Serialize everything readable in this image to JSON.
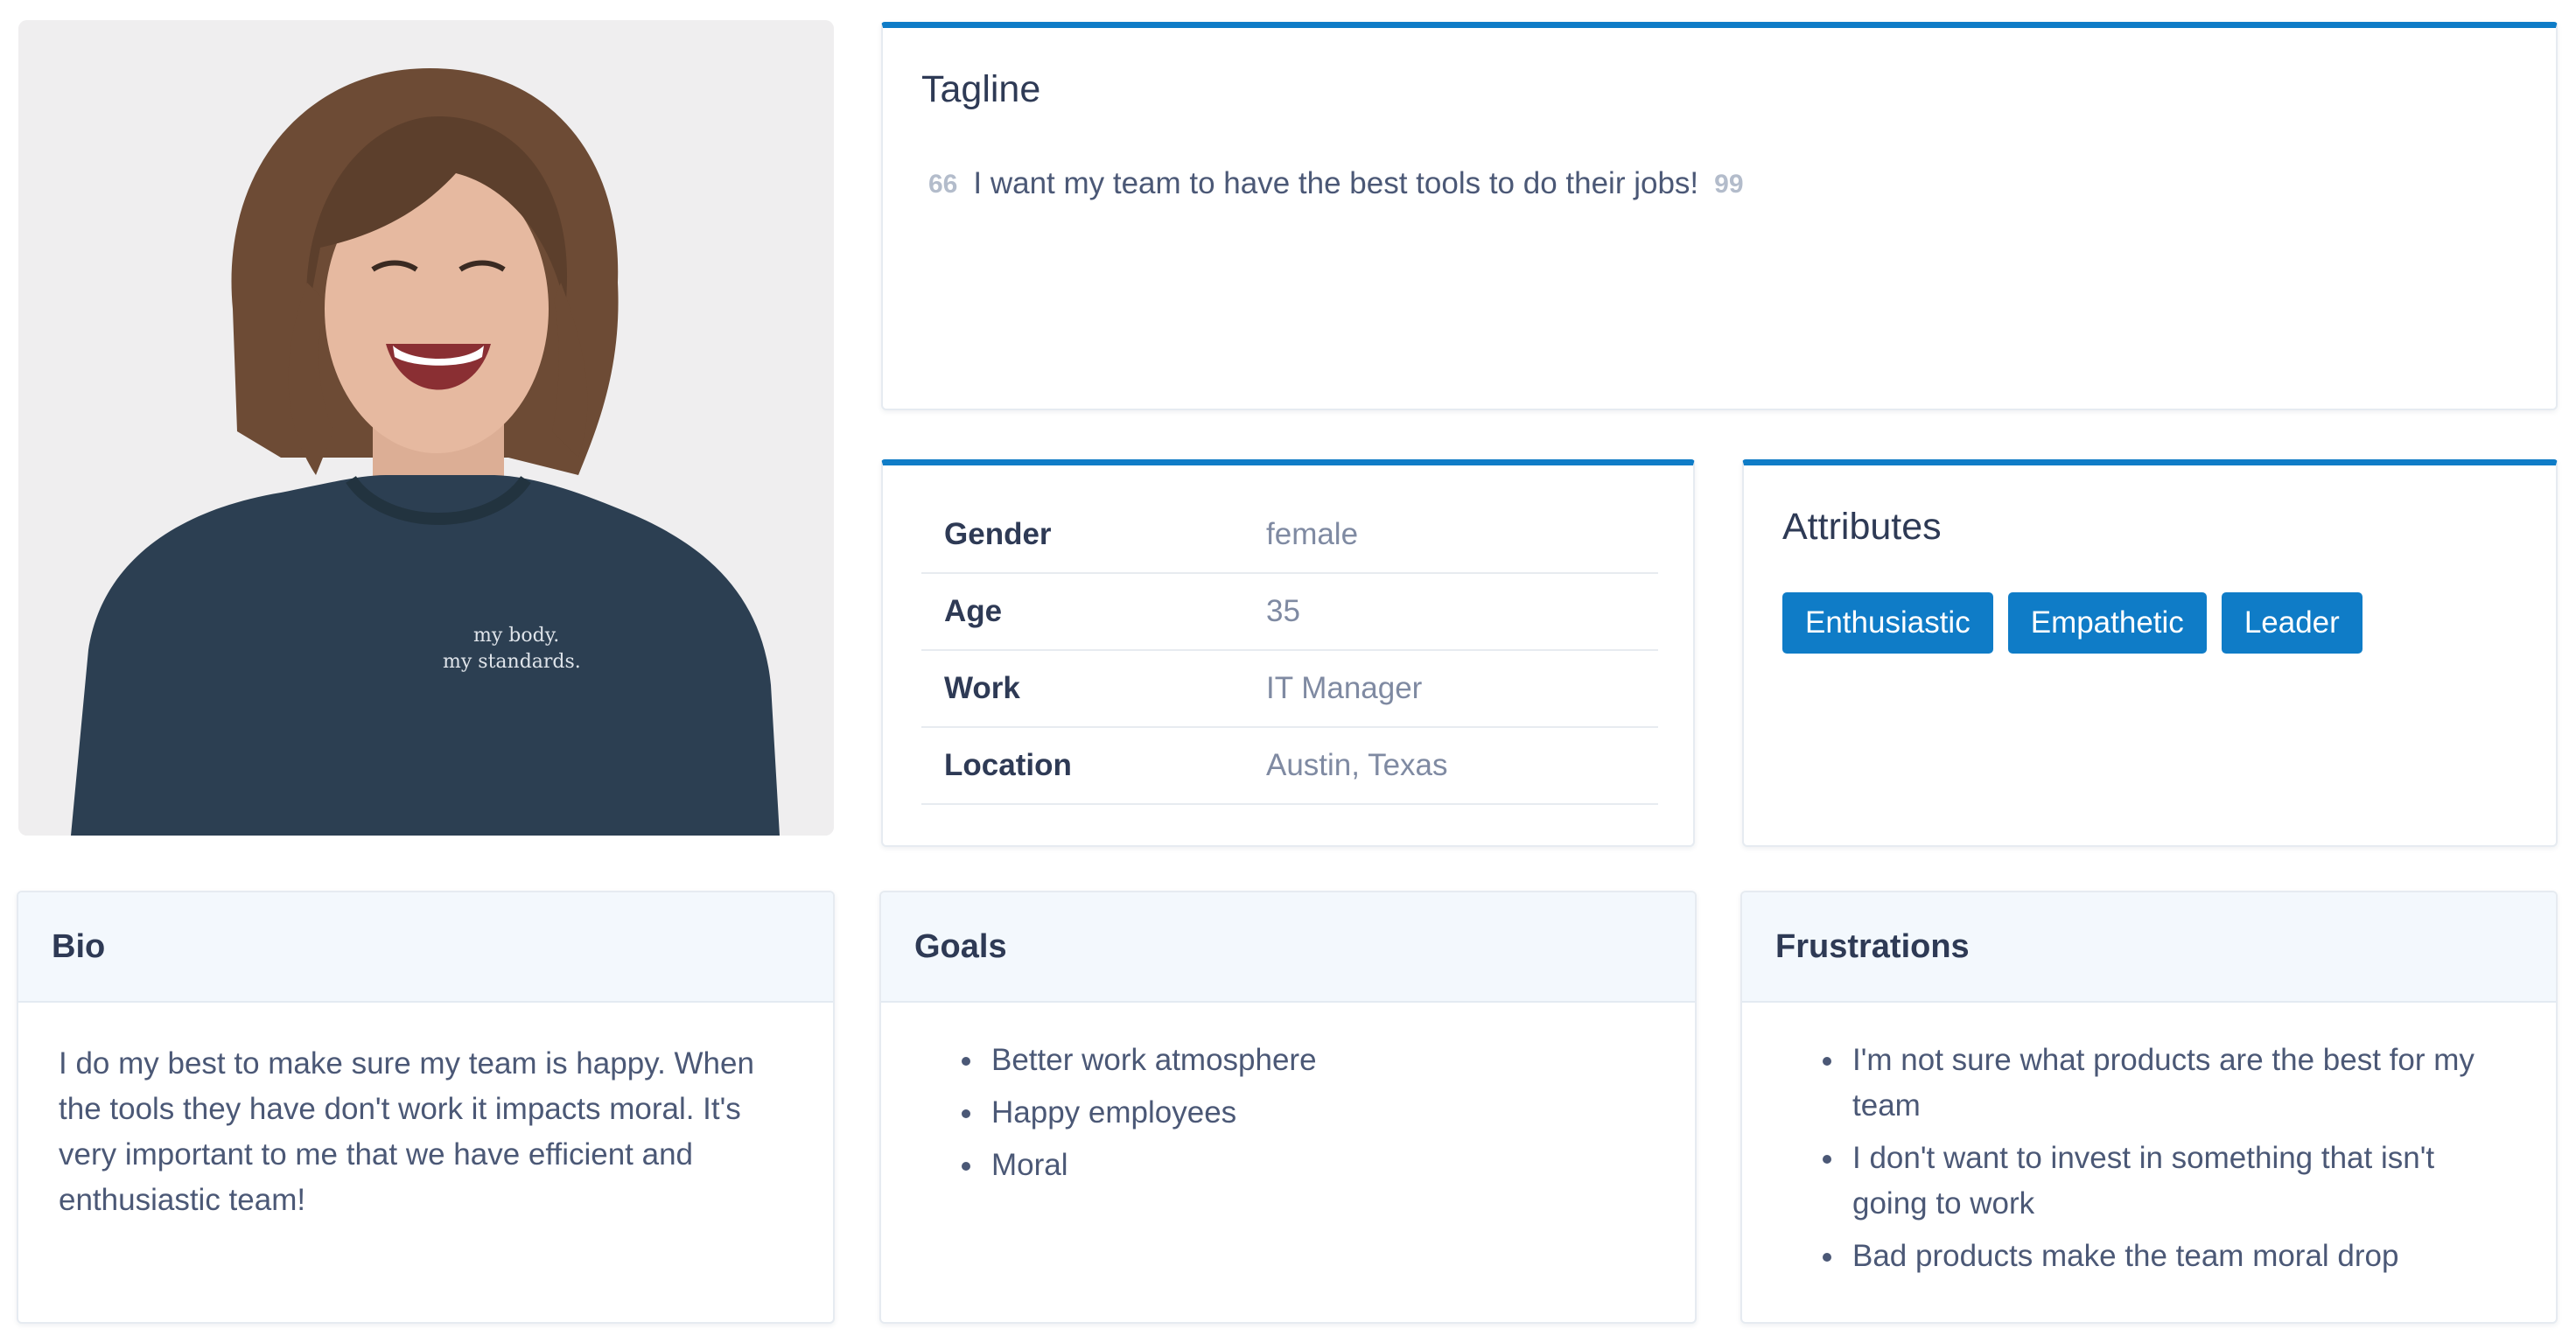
{
  "persona": {
    "photo": {
      "name": "portrait-photo",
      "shirt_text": [
        "my body.",
        "my standards."
      ]
    },
    "tagline": {
      "title": "Tagline",
      "open_quote": "66",
      "text": "I want my team to have the best tools to do their jobs!",
      "close_quote": "99"
    },
    "info": [
      {
        "label": "Gender",
        "value": "female"
      },
      {
        "label": "Age",
        "value": "35"
      },
      {
        "label": "Work",
        "value": "IT Manager"
      },
      {
        "label": "Location",
        "value": "Austin, Texas"
      }
    ],
    "attributes": {
      "title": "Attributes",
      "items": [
        "Enthusiastic",
        "Empathetic",
        "Leader"
      ]
    },
    "bio": {
      "title": "Bio",
      "text": "I do my best to make sure my team is happy. When the tools they have don't work it impacts moral. It's very important to me that we have efficient and enthusiastic team!"
    },
    "goals": {
      "title": "Goals",
      "items": [
        "Better work atmosphere",
        "Happy employees",
        "Moral"
      ]
    },
    "frustrations": {
      "title": "Frustrations",
      "items": [
        "I'm not sure what products are the best for my team",
        "I don't want to invest in something that isn't going to work",
        "Bad products make the team moral drop"
      ]
    }
  },
  "colors": {
    "accent": "#0f7cc7",
    "heading": "#2e3a55",
    "body_text": "#4b5876",
    "muted_value": "#7f8aa2",
    "panel_header_bg": "#f3f8fd"
  }
}
